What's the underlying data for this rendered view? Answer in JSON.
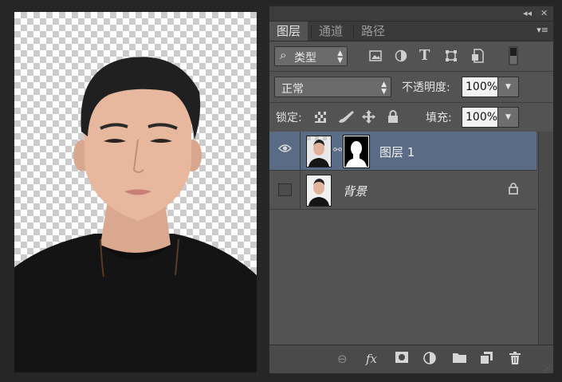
{
  "panel": {
    "collapse_glyph": "◂◂",
    "close_glyph": "✕",
    "menu_glyph": "▾≡",
    "tabs": [
      {
        "label": "图层",
        "active": true
      },
      {
        "label": "通道",
        "active": false
      },
      {
        "label": "路径",
        "active": false
      }
    ],
    "filter": {
      "search_glyph": "⌕",
      "kind_label": "类型",
      "icons": [
        "image-filter-icon",
        "adjustment-filter-icon",
        "type-filter-icon",
        "shape-filter-icon",
        "smart-object-filter-icon",
        "filter-toggle-icon"
      ]
    },
    "blend": {
      "mode": "正常",
      "opacity_label": "不透明度:",
      "opacity_value": "100%"
    },
    "lock": {
      "label": "锁定:",
      "icons": [
        "lock-transparent-pixels-icon",
        "lock-image-pixels-icon",
        "lock-position-icon",
        "lock-all-icon"
      ],
      "fill_label": "填充:",
      "fill_value": "100%"
    },
    "layers": [
      {
        "name": "图层 1",
        "visible": true,
        "selected": true,
        "has_mask": true,
        "locked": false
      },
      {
        "name": "背景",
        "visible": false,
        "selected": false,
        "has_mask": false,
        "locked": true
      }
    ],
    "bottom_icons": [
      "link-layers-icon",
      "layer-style-icon",
      "add-mask-icon",
      "new-adjustment-icon",
      "new-group-icon",
      "new-layer-icon",
      "delete-layer-icon"
    ],
    "bottom_glyphs": {
      "link": "⊖",
      "fx": "fx",
      "mask": "◙",
      "adjust": "◐",
      "group": "▬",
      "new_layer": "▢",
      "trash": "🗑"
    }
  },
  "colors": {
    "panel_bg": "#535353",
    "selected_layer": "#5a6c85",
    "app_bg": "#262626"
  }
}
